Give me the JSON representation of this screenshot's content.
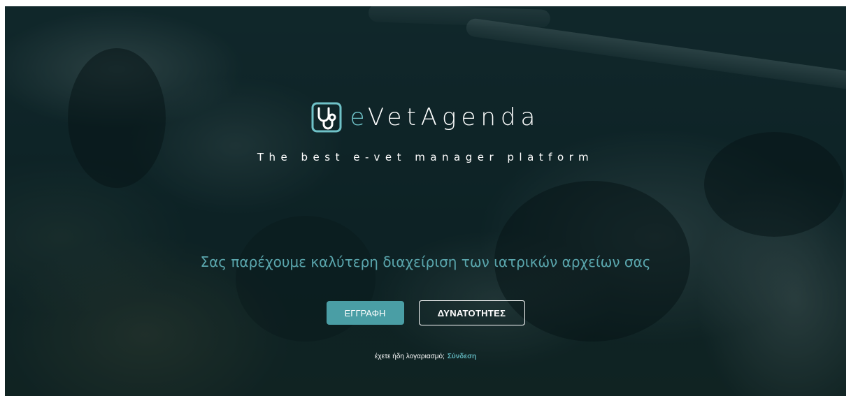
{
  "brand": {
    "name_accent": "e",
    "name_rest": "VetAgenda",
    "logo_icon": "stethoscope-icon",
    "accent_color": "#6fc2c8"
  },
  "hero": {
    "tagline": "The best e-vet manager platform",
    "subtitle": "Σας παρέχουμε καλύτερη διαχείριση των ιατρικών αρχείων σας"
  },
  "actions": {
    "register_label": "ΕΓΓΡΑΦΗ",
    "features_label": "ΔΥΝΑΤΟΤΗΤΕΣ"
  },
  "login": {
    "prompt": "έχετε ήδη λογαριασμό;",
    "link_label": "Σύνδεση"
  },
  "colors": {
    "primary_button": "#4a9ea5",
    "subtitle_text": "#5aa6ad",
    "overlay": "#0c262a"
  }
}
